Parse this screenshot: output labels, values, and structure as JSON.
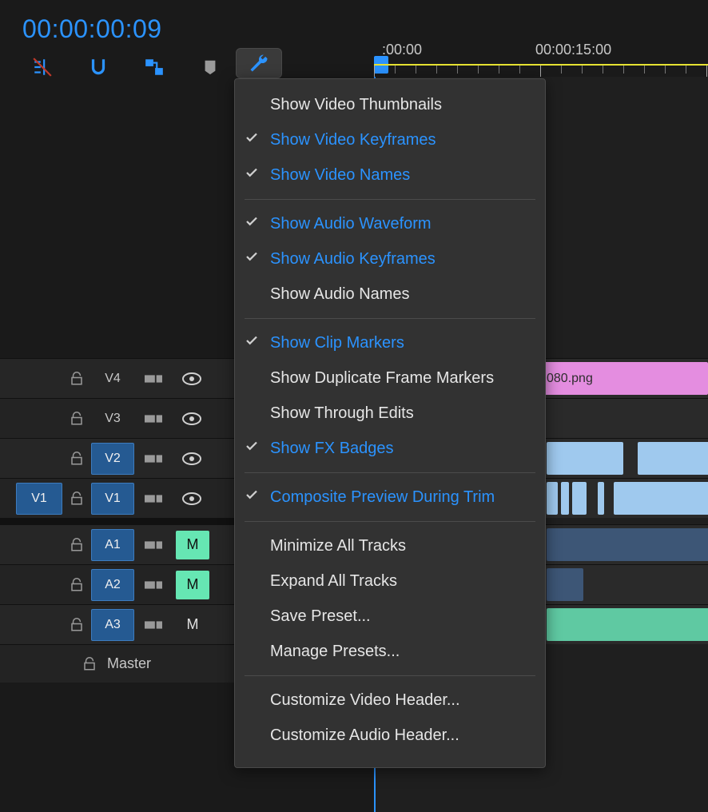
{
  "timecode": "00:00:00:09",
  "ruler": {
    "t0": ":00:00",
    "t1": "00:00:15:00"
  },
  "toolbar": {
    "tools": [
      {
        "name": "insert-overwrite-icon"
      },
      {
        "name": "snap-icon"
      },
      {
        "name": "linked-selection-icon"
      },
      {
        "name": "marker-icon"
      },
      {
        "name": "wrench-icon"
      }
    ]
  },
  "menu": {
    "items": [
      {
        "label": "Show Video Thumbnails",
        "checked": false,
        "enabled": false
      },
      {
        "label": "Show Video Keyframes",
        "checked": true,
        "enabled": true
      },
      {
        "label": "Show Video Names",
        "checked": true,
        "enabled": true
      },
      {
        "sep": true
      },
      {
        "label": "Show Audio Waveform",
        "checked": true,
        "enabled": true
      },
      {
        "label": "Show Audio Keyframes",
        "checked": true,
        "enabled": true
      },
      {
        "label": "Show Audio Names",
        "checked": false,
        "enabled": false
      },
      {
        "sep": true
      },
      {
        "label": "Show Clip Markers",
        "checked": true,
        "enabled": true
      },
      {
        "label": "Show Duplicate Frame Markers",
        "checked": false,
        "enabled": false
      },
      {
        "label": "Show Through Edits",
        "checked": false,
        "enabled": false
      },
      {
        "label": "Show FX Badges",
        "checked": true,
        "enabled": true
      },
      {
        "sep": true
      },
      {
        "label": "Composite Preview During Trim",
        "checked": true,
        "enabled": true
      },
      {
        "sep": true
      },
      {
        "label": "Minimize All Tracks",
        "action": true
      },
      {
        "label": "Expand All Tracks",
        "action": true
      },
      {
        "label": "Save Preset...",
        "action": true
      },
      {
        "label": "Manage Presets...",
        "action": true
      },
      {
        "sep": true
      },
      {
        "label": "Customize Video Header...",
        "action": true
      },
      {
        "label": "Customize Audio Header...",
        "action": true
      }
    ]
  },
  "tracks": {
    "video": [
      {
        "src": "",
        "targetLabel": "V4",
        "targetOn": false
      },
      {
        "src": "",
        "targetLabel": "V3",
        "targetOn": false
      },
      {
        "src": "",
        "targetLabel": "V2",
        "targetOn": true
      },
      {
        "src": "V1",
        "srcOn": true,
        "targetLabel": "V1",
        "targetOn": true
      }
    ],
    "audio": [
      {
        "targetLabel": "A1",
        "targetOn": true,
        "mute": "M",
        "muteOn": true
      },
      {
        "targetLabel": "A2",
        "targetOn": true,
        "mute": "M",
        "muteOn": true
      },
      {
        "targetLabel": "A3",
        "targetOn": true,
        "mute": "M",
        "muteOn": false
      }
    ],
    "master": {
      "label": "Master"
    }
  },
  "clips": {
    "pink_label": "080.png"
  },
  "colors": {
    "accent": "#2b93ff",
    "mute_on": "#66e6b3",
    "clip_pink": "#e48de0",
    "clip_video": "#9fc9ee",
    "clip_audio": "#3d5676",
    "clip_wave": "#5fc9a2"
  }
}
